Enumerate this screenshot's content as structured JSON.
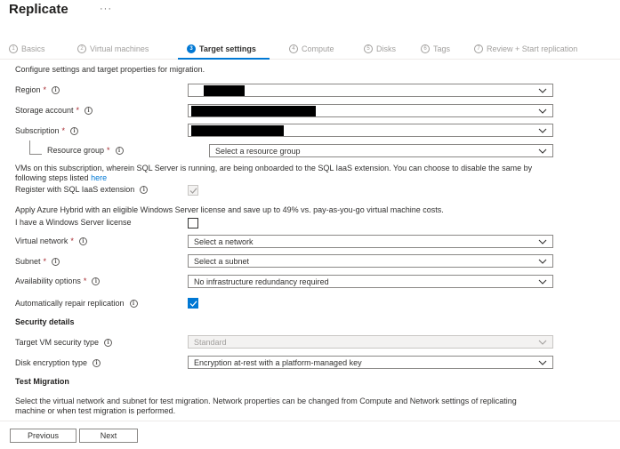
{
  "header": {
    "title": "Replicate",
    "more_glyph": "···"
  },
  "wizard": {
    "steps": [
      {
        "num": "1",
        "label": "Basics",
        "state": "done"
      },
      {
        "num": "2",
        "label": "Virtual machines",
        "state": "done"
      },
      {
        "num": "3",
        "label": "Target settings",
        "state": "active"
      },
      {
        "num": "4",
        "label": "Compute",
        "state": "pending"
      },
      {
        "num": "5",
        "label": "Disks",
        "state": "pending"
      },
      {
        "num": "6",
        "label": "Tags",
        "state": "pending"
      },
      {
        "num": "7",
        "label": "Review + Start replication",
        "state": "pending"
      }
    ]
  },
  "form": {
    "intro": "Configure settings and target properties for migration.",
    "region": {
      "label": "Region",
      "required": "*",
      "value": ""
    },
    "storage_account": {
      "label": "Storage account",
      "required": "*",
      "value": ""
    },
    "subscription": {
      "label": "Subscription",
      "required": "*",
      "value": ""
    },
    "resource_group": {
      "label": "Resource group",
      "required": "*",
      "placeholder": "Select a resource group"
    },
    "sql_note": "VMs on this subscription, wherein SQL Server is running, are being onboarded to the SQL IaaS extension. You can choose to disable the same by following steps listed",
    "sql_note_link": "here",
    "sql_register": {
      "label": "Register with SQL IaaS extension",
      "checked": true,
      "disabled": true
    },
    "hybrid_note": "Apply Azure Hybrid with an eligible Windows Server license and save up to 49% vs. pay-as-you-go virtual machine costs.",
    "windows_license": {
      "label": "I have a Windows Server license",
      "checked": false
    },
    "virtual_network": {
      "label": "Virtual network",
      "required": "*",
      "placeholder": "Select a network"
    },
    "subnet": {
      "label": "Subnet",
      "required": "*",
      "placeholder": "Select a subnet"
    },
    "availability": {
      "label": "Availability options",
      "required": "*",
      "value": "No infrastructure redundancy required"
    },
    "auto_repair": {
      "label": "Automatically repair replication",
      "checked": true
    }
  },
  "security": {
    "heading": "Security details",
    "vm_security_type": {
      "label": "Target VM security type",
      "value": "Standard",
      "disabled": true
    },
    "disk_encryption": {
      "label": "Disk encryption type",
      "value": "Encryption at-rest with a platform-managed key"
    }
  },
  "test_migration": {
    "heading": "Test Migration",
    "note": "Select the virtual network and subnet for test migration. Network properties can be changed from Compute and Network settings of replicating machine or when test migration is performed."
  },
  "footer": {
    "previous_label": "Previous",
    "next_label": "Next"
  },
  "colors": {
    "accent": "#0078d4",
    "required": "#a4262c",
    "redaction": "#000000"
  },
  "icons": {
    "info": "info-icon",
    "chevron": "chevron-down-icon",
    "check": "checkmark-icon"
  }
}
